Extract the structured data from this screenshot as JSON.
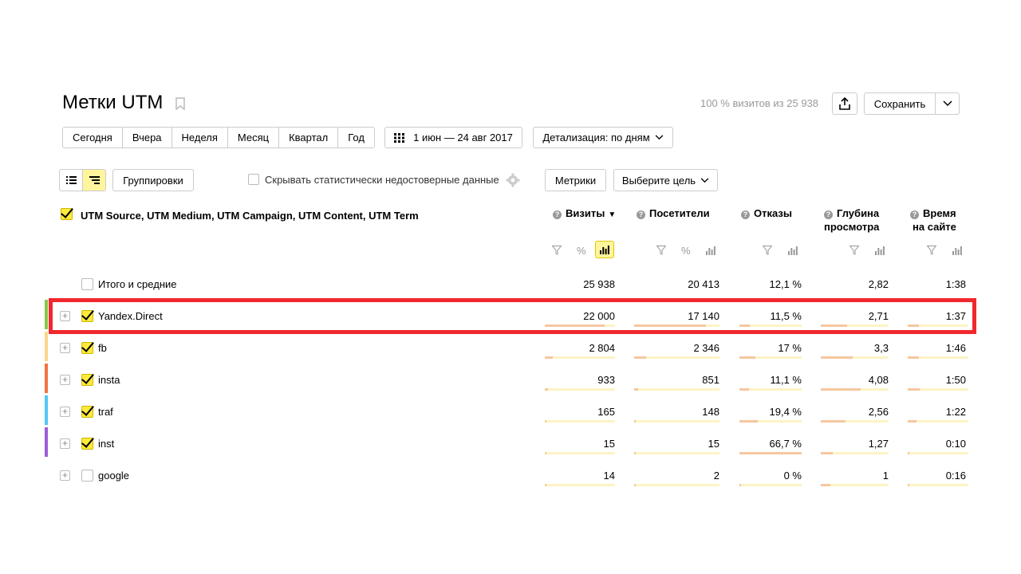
{
  "header": {
    "title": "Метки UTM",
    "visits_summary": "100 % визитов из 25 938",
    "save_label": "Сохранить"
  },
  "period": {
    "buttons": [
      "Сегодня",
      "Вчера",
      "Неделя",
      "Месяц",
      "Квартал",
      "Год"
    ],
    "date_range": "1 июн — 24 авг 2017",
    "detail": "Детализация: по дням"
  },
  "toolbar": {
    "groups_label": "Группировки",
    "hide_unreliable_label": "Скрывать статистически недостоверные данные",
    "metrics_label": "Метрики",
    "goal_label": "Выберите цель"
  },
  "table": {
    "dimensions_label": "UTM Source, UTM Medium, UTM Campaign, UTM Content, UTM Term",
    "columns": [
      {
        "line1": "Визиты",
        "line2": ""
      },
      {
        "line1": "Посетители",
        "line2": ""
      },
      {
        "line1": "Отказы",
        "line2": ""
      },
      {
        "line1": "Глубина",
        "line2": "просмотра"
      },
      {
        "line1": "Время",
        "line2": "на сайте"
      }
    ],
    "totals": {
      "label": "Итого и средние",
      "values": [
        "25 938",
        "20 413",
        "12,1 %",
        "2,82",
        "1:38"
      ]
    },
    "rows": [
      {
        "label": "Yandex.Direct",
        "checked": true,
        "color": "#8bc34a",
        "values": [
          "22 000",
          "17 140",
          "11,5 %",
          "2,71",
          "1:37"
        ],
        "bars": [
          0.85,
          0.84,
          0.17,
          0.39,
          0.18
        ]
      },
      {
        "label": "fb",
        "checked": true,
        "color": "#fdd58a",
        "values": [
          "2 804",
          "2 346",
          "17 %",
          "3,3",
          "1:46"
        ],
        "bars": [
          0.11,
          0.14,
          0.25,
          0.47,
          0.19
        ]
      },
      {
        "label": "insta",
        "checked": true,
        "color": "#f4733f",
        "values": [
          "933",
          "851",
          "11,1 %",
          "4,08",
          "1:50"
        ],
        "bars": [
          0.04,
          0.05,
          0.16,
          0.59,
          0.2
        ]
      },
      {
        "label": "traf",
        "checked": true,
        "color": "#52c8f5",
        "values": [
          "165",
          "148",
          "19,4 %",
          "2,56",
          "1:22"
        ],
        "bars": [
          0.01,
          0.01,
          0.29,
          0.37,
          0.15
        ]
      },
      {
        "label": "inst",
        "checked": true,
        "color": "#9b5fd6",
        "values": [
          "15",
          "15",
          "66,7 %",
          "1,27",
          "0:10"
        ],
        "bars": [
          0.002,
          0.002,
          1.0,
          0.18,
          0.02
        ]
      },
      {
        "label": "google",
        "checked": false,
        "color": "",
        "values": [
          "14",
          "2",
          "0 %",
          "1",
          "0:16"
        ],
        "bars": [
          0.002,
          0.001,
          0.0,
          0.14,
          0.03
        ]
      }
    ]
  },
  "colors": {
    "accent_yellow": "#ffeb3b",
    "highlight_red": "#f0282d",
    "bar": "#f5c7a0",
    "bar_bg": "#fdf3c4"
  }
}
